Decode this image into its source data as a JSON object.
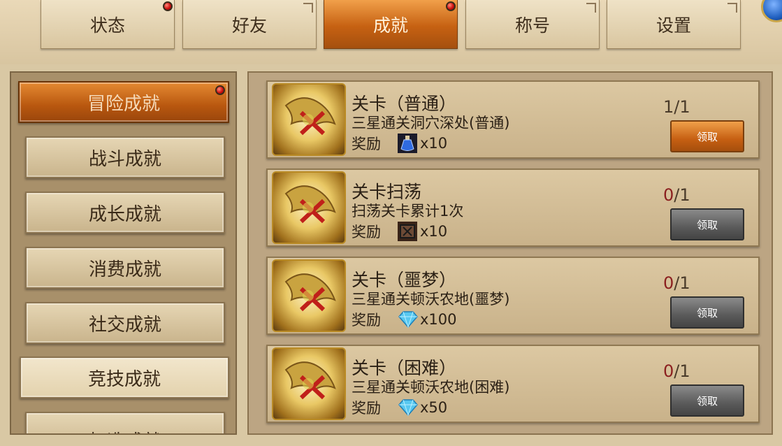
{
  "tabs": [
    {
      "label": "状态",
      "active": false,
      "badge": true
    },
    {
      "label": "好友",
      "active": false,
      "badge": false
    },
    {
      "label": "成就",
      "active": true,
      "badge": true
    },
    {
      "label": "称号",
      "active": false,
      "badge": false
    },
    {
      "label": "设置",
      "active": false,
      "badge": false
    }
  ],
  "categories": [
    {
      "label": "冒险成就",
      "active": true,
      "badge": true
    },
    {
      "label": "战斗成就",
      "active": false
    },
    {
      "label": "成长成就",
      "active": false
    },
    {
      "label": "消费成就",
      "active": false
    },
    {
      "label": "社交成就",
      "active": false
    },
    {
      "label": "竞技成就",
      "active": false
    },
    {
      "label": "打造成就",
      "active": false
    }
  ],
  "achievements": [
    {
      "title": "关卡（普通）",
      "desc": "三星通关洞穴深处(普通)",
      "reward_label": "奖励",
      "reward_icon": "potion-icon",
      "reward_qty": "x10",
      "current": "1",
      "separator": "/",
      "total": "1",
      "claim_label": "领取",
      "claimable": true
    },
    {
      "title": "关卡扫荡",
      "desc": "扫荡关卡累计1次",
      "reward_label": "奖励",
      "reward_icon": "scroll-item-icon",
      "reward_qty": "x10",
      "current": "0",
      "separator": "/",
      "total": "1",
      "claim_label": "领取",
      "claimable": false
    },
    {
      "title": "关卡（噩梦）",
      "desc": "三星通关顿沃农地(噩梦)",
      "reward_label": "奖励",
      "reward_icon": "diamond-icon",
      "reward_qty": "x100",
      "current": "0",
      "separator": "/",
      "total": "1",
      "claim_label": "领取",
      "claimable": false
    },
    {
      "title": "关卡（困难）",
      "desc": "三星通关顿沃农地(困难)",
      "reward_label": "奖励",
      "reward_icon": "diamond-icon",
      "reward_qty": "x50",
      "current": "0",
      "separator": "/",
      "total": "1",
      "claim_label": "领取",
      "claimable": false
    }
  ]
}
